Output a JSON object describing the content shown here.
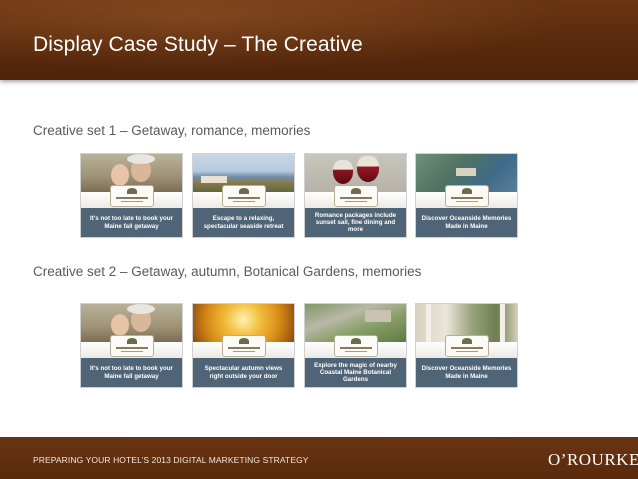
{
  "header": {
    "title": "Display Case Study – The Creative"
  },
  "sets": [
    {
      "label": "Creative set 1 – Getaway, romance, memories",
      "ads": [
        {
          "caption": "It's not too late to book your Maine fall getaway",
          "image": "couple-photo"
        },
        {
          "caption": "Escape to a relaxing, spectacular seaside retreat",
          "image": "seaside-photo"
        },
        {
          "caption": "Romance packages include sunset sail, fine dining and more",
          "image": "wine-glasses-photo"
        },
        {
          "caption": "Discover Oceanside Memories Made in Maine",
          "image": "coastal-aerial-photo"
        }
      ]
    },
    {
      "label": "Creative set 2 – Getaway, autumn, Botanical Gardens, memories",
      "ads": [
        {
          "caption": "It's not too late to book your Maine fall getaway",
          "image": "couple-photo"
        },
        {
          "caption": "Spectacular autumn views right outside your door",
          "image": "autumn-trees-photo"
        },
        {
          "caption": "Explore the magic of nearby Coastal Maine Botanical Gardens",
          "image": "botanical-garden-photo"
        },
        {
          "caption": "Discover Oceanside Memories Made in Maine",
          "image": "porch-view-photo"
        }
      ]
    }
  ],
  "footer": {
    "text": "PREPARING YOUR HOTEL’S 2013 DIGITAL MARKETING STRATEGY",
    "brand": "O’ROURKE"
  },
  "colors": {
    "header_brown": "#5a2a0c",
    "caption_slate": "#4f6477",
    "label_gray": "#5a5a5a"
  }
}
